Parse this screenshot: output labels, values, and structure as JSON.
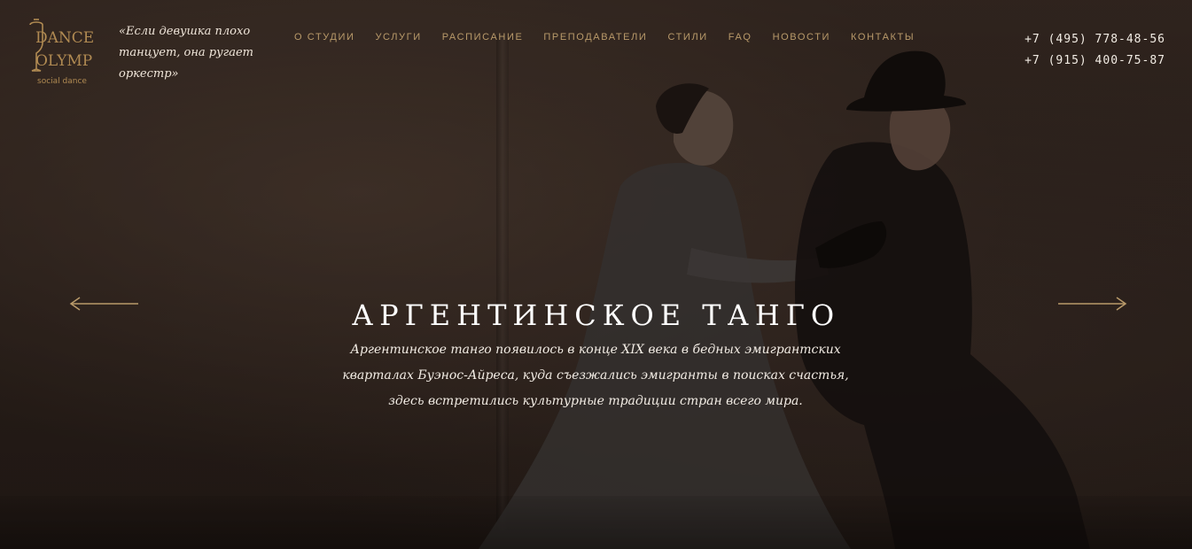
{
  "logo": {
    "line1": "DANCE",
    "line2": "OLYMP",
    "line3": "social dance",
    "color": "#b08a52"
  },
  "quote": "«Если девушка плохо танцует, она ругает оркестр»",
  "nav": {
    "items": [
      {
        "label": "О СТУДИИ"
      },
      {
        "label": "УСЛУГИ"
      },
      {
        "label": "РАСПИСАНИЕ"
      },
      {
        "label": "ПРЕПОДАВАТЕЛИ"
      },
      {
        "label": "СТИЛИ"
      },
      {
        "label": "FAQ"
      },
      {
        "label": "НОВОСТИ"
      },
      {
        "label": "КОНТАКТЫ"
      }
    ]
  },
  "phones": [
    "+7 (495) 778-48-56",
    "+7 (915) 400-75-87"
  ],
  "slide": {
    "title": "АРГЕНТИНСКОЕ ТАНГО",
    "lines": [
      "Аргентинское танго появилось в конце XIX века в бедных эмигрантских",
      "кварталах Буэнос-Айреса, куда съезжались эмигранты в поисках счастья,",
      "здесь встретились культурные традиции стран всего мира."
    ]
  },
  "colors": {
    "accent": "#b99a6a",
    "text": "#ffffff"
  },
  "icons": {
    "prev": "arrow-left-icon",
    "next": "arrow-right-icon"
  }
}
